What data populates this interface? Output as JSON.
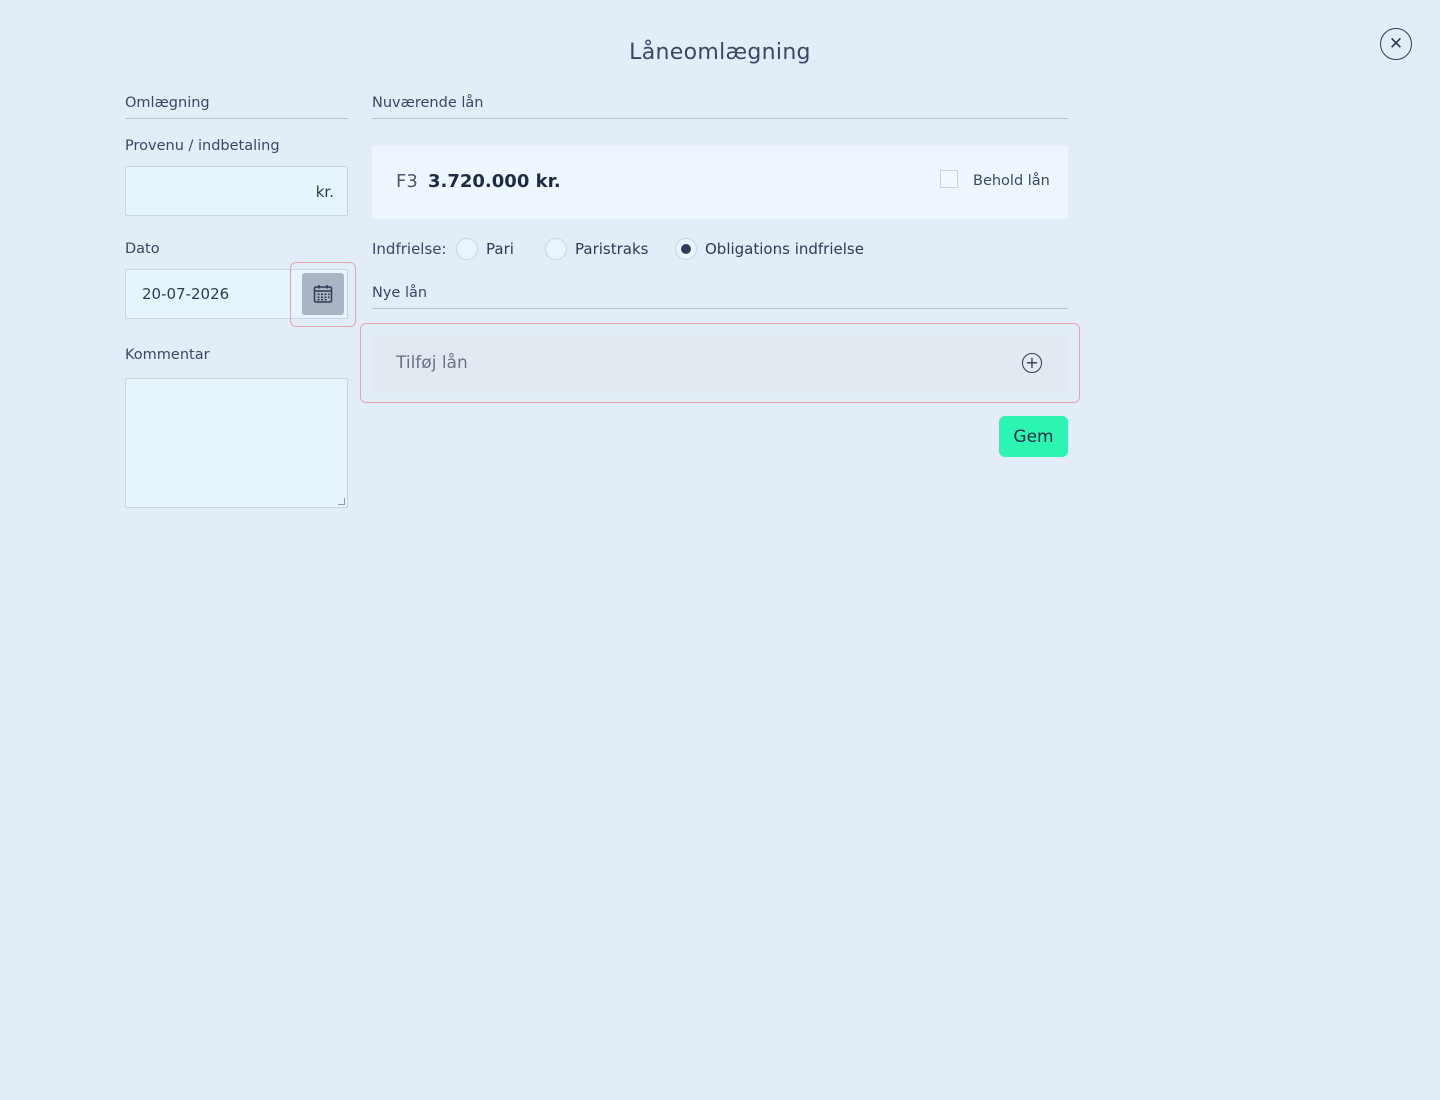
{
  "dialog": {
    "title": "Låneomlægning",
    "close_icon": "close-icon"
  },
  "left": {
    "section_title": "Omlægning",
    "proceeds": {
      "label": "Provenu / indbetaling",
      "value": "",
      "suffix": "kr."
    },
    "date": {
      "label": "Dato",
      "value": "20-07-2026",
      "icon": "calendar-icon"
    },
    "comment": {
      "label": "Kommentar",
      "value": ""
    }
  },
  "current_loans": {
    "section_title": "Nuværende lån",
    "loan": {
      "code": "F3",
      "amount": "3.720.000 kr.",
      "keep_label": "Behold lån",
      "keep_checked": false
    },
    "redemption": {
      "label": "Indfrielse:",
      "options": [
        "Pari",
        "Paristraks",
        "Obligations indfrielse"
      ],
      "selected": "Obligations indfrielse"
    }
  },
  "new_loans": {
    "section_title": "Nye lån",
    "add_label": "Tilføj lån",
    "add_icon": "plus-circle-icon"
  },
  "actions": {
    "save_label": "Gem"
  },
  "colors": {
    "background": "#e2edf8",
    "save_button": "#2bf5b0",
    "highlight_border": "#e6a5ad"
  }
}
